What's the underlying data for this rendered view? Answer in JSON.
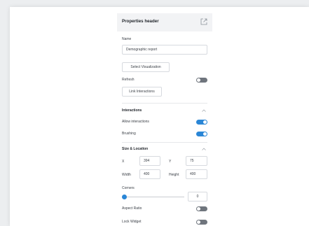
{
  "panel": {
    "title": "Properties header",
    "icons": {
      "popout": "popout-icon",
      "chevron": "chevron-up-icon"
    },
    "accent_color": "#2a86d6"
  },
  "name_field": {
    "label": "Name",
    "value": "Demographic report"
  },
  "select_visualization": "Select Visualization",
  "refresh": {
    "label": "Refresh",
    "on": false
  },
  "link_interactions": "Link Interactions",
  "interactions": {
    "title": "Interactions",
    "allow": {
      "label": "Allow interactions",
      "on": true
    },
    "brushing": {
      "label": "Brushing",
      "on": true
    }
  },
  "size_location": {
    "title": "Size & Location",
    "x_label": "X",
    "x_value": "394",
    "y_label": "Y",
    "y_value": "75",
    "width_label": "Width",
    "width_value": "400",
    "height_label": "Height",
    "height_value": "400",
    "corners": {
      "label": "Corners",
      "value": "0"
    },
    "aspect_ratio": {
      "label": "Aspect Ratio",
      "on": false
    },
    "lock_widget": {
      "label": "Lock Widget",
      "on": false
    }
  }
}
